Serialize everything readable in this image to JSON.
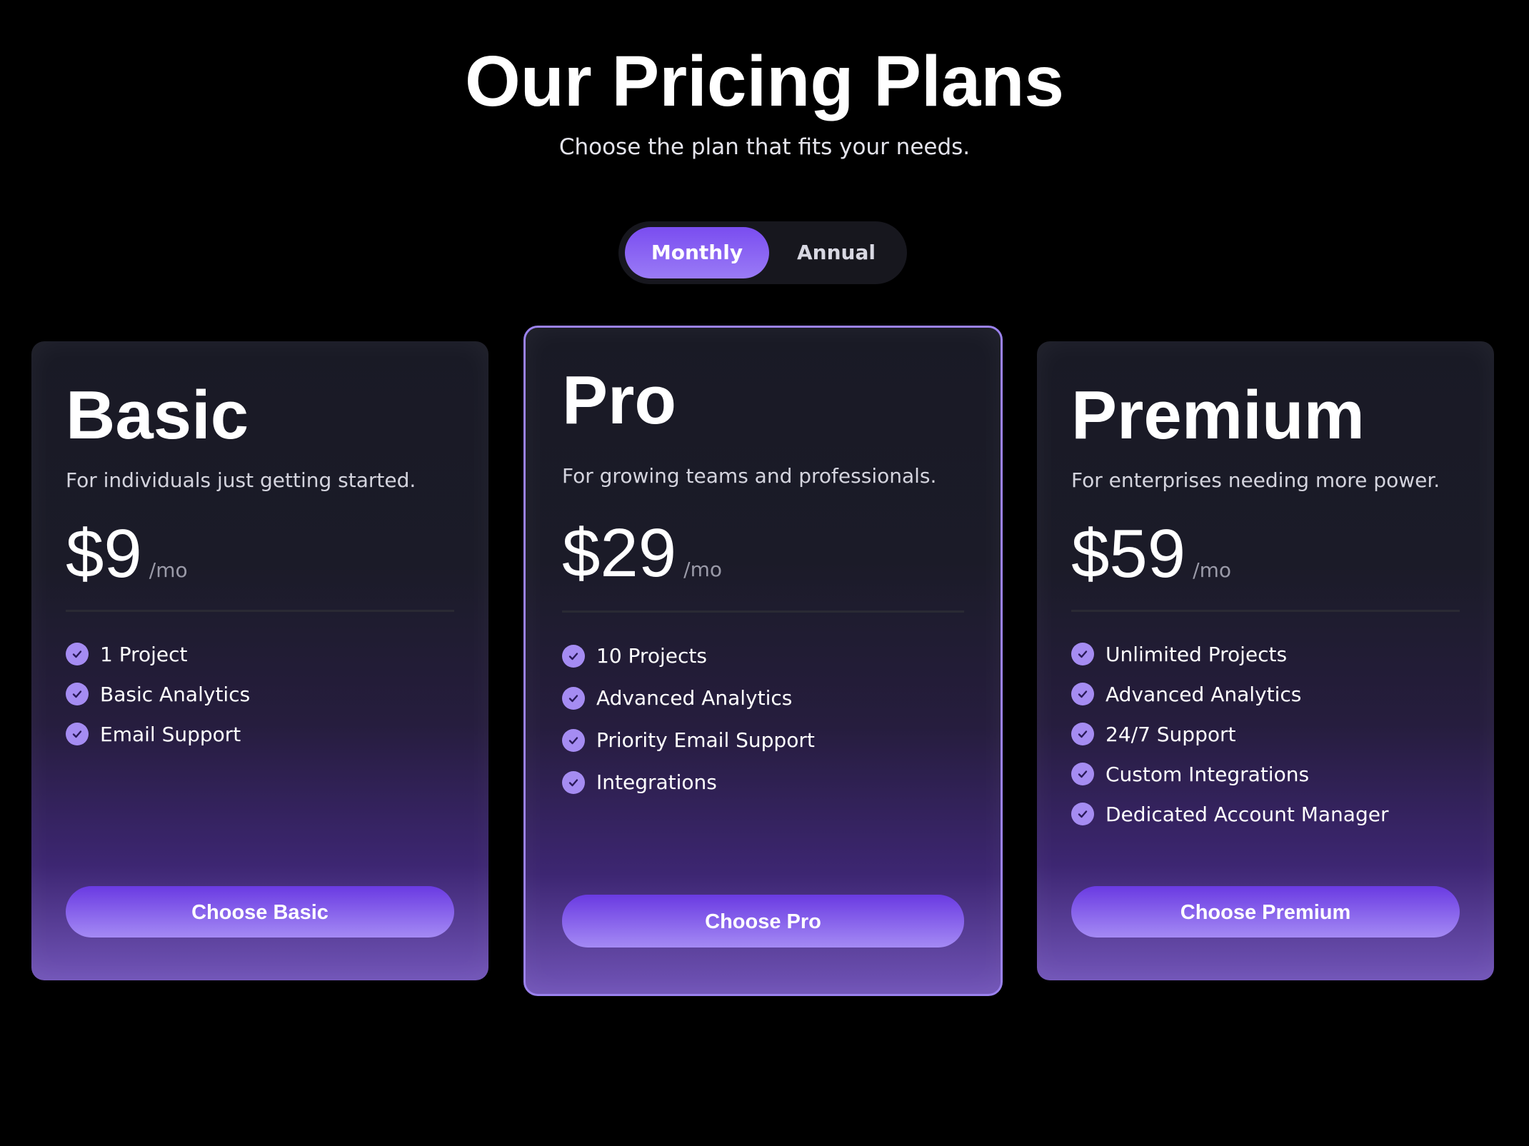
{
  "header": {
    "title": "Our Pricing Plans",
    "subtitle": "Choose the plan that fits your needs."
  },
  "billing_toggle": {
    "options": [
      "Monthly",
      "Annual"
    ],
    "selected": "Monthly"
  },
  "colors": {
    "accent": "#7a4df0",
    "highlight_border": "#9b82ee",
    "check": "#a58cf2",
    "background": "#000000"
  },
  "plans": [
    {
      "name": "Basic",
      "description": "For individuals just getting started.",
      "price": "$9",
      "period": "/mo",
      "features": [
        "1 Project",
        "Basic Analytics",
        "Email Support"
      ],
      "cta": "Choose Basic",
      "icon": "check-circle-icon"
    },
    {
      "name": "Pro",
      "description": "For growing teams and professionals.",
      "price": "$29",
      "period": "/mo",
      "features": [
        "10 Projects",
        "Advanced Analytics",
        "Priority Email Support",
        "Integrations"
      ],
      "cta": "Choose Pro",
      "highlighted": true,
      "icon": "check-circle-icon"
    },
    {
      "name": "Premium",
      "description": "For enterprises needing more power.",
      "price": "$59",
      "period": "/mo",
      "features": [
        "Unlimited Projects",
        "Advanced Analytics",
        "24/7 Support",
        "Custom Integrations",
        "Dedicated Account Manager"
      ],
      "cta": "Choose Premium",
      "icon": "check-circle-icon"
    }
  ]
}
